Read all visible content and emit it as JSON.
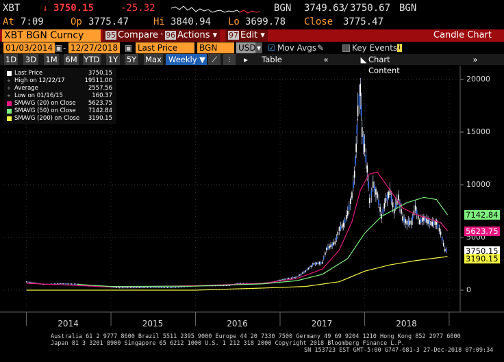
{
  "quote": {
    "ticker": "XBT",
    "arrow": "↓",
    "last": "3750.15",
    "change": "-25.32",
    "source": "BGN",
    "bid": "3749.63",
    "ask": "3750.67",
    "source2": "BGN",
    "at_label": "At",
    "time": "7:09",
    "op_label": "Op",
    "open": "3775.47",
    "hi_label": "Hi",
    "high": "3840.94",
    "lo_label": "Lo",
    "low": "3699.78",
    "close_label": "Close",
    "close": "3775.47"
  },
  "menubar": {
    "security": "XBT BGN Curncy",
    "compare_num": "95",
    "compare": "Compare",
    "actions_num": "96",
    "actions": "Actions",
    "edit_num": "97",
    "edit": "Edit",
    "chart_type": "Candle Chart"
  },
  "controls": {
    "start_date": "01/03/2014",
    "end_date": "12/27/2018",
    "field": "Last Price",
    "source": "BGN",
    "currency": "USD",
    "mov_avgs": "Mov Avgs",
    "key_events": "Key Events"
  },
  "periods": {
    "items": [
      "1D",
      "3D",
      "1M",
      "6M",
      "YTD",
      "1Y",
      "5Y",
      "Max"
    ],
    "frequency": "Weekly",
    "table": "Table",
    "chart_content": "Chart Content"
  },
  "legend": {
    "rows": [
      {
        "label": "Last Price",
        "value": "3750.15",
        "color": "#ffffff"
      },
      {
        "label": "High on 12/22/17",
        "value": "19511.00",
        "color": "#ffffff"
      },
      {
        "label": "Average",
        "value": "2557.56",
        "color": "#ffffff"
      },
      {
        "label": "Low on 01/16/15",
        "value": "160.37",
        "color": "#ffffff"
      },
      {
        "label": "SMAVG (20)  on Close",
        "value": "5623.75",
        "color": "#e8177f"
      },
      {
        "label": "SMAVG (50)  on Close",
        "value": "7142.84",
        "color": "#7ef07e"
      },
      {
        "label": "SMAVG (200)  on Close",
        "value": "3190.15",
        "color": "#f5f542"
      }
    ]
  },
  "tags": {
    "sma50": "7142.84",
    "sma20": "5623.75",
    "last": "3750.15",
    "sma200": "3190.15"
  },
  "chart_data": {
    "type": "line",
    "y_ticks": [
      "20000",
      "15000",
      "10000",
      "5000",
      "0"
    ],
    "ylim": [
      -1500,
      21500
    ],
    "x_ticks": [
      "2014",
      "2015",
      "2016",
      "2017",
      "2018"
    ],
    "series": [
      {
        "name": "Last Price",
        "color": "#4a90ff",
        "x": [
          2014.0,
          2014.2,
          2014.4,
          2014.6,
          2014.8,
          2015.0,
          2015.1,
          2015.3,
          2015.5,
          2015.7,
          2015.9,
          2016.0,
          2016.2,
          2016.4,
          2016.5,
          2016.7,
          2016.9,
          2017.0,
          2017.1,
          2017.2,
          2017.3,
          2017.4,
          2017.5,
          2017.55,
          2017.6,
          2017.65,
          2017.7,
          2017.75,
          2017.8,
          2017.85,
          2017.88,
          2017.9,
          2017.92,
          2017.95,
          2017.97,
          2018.0,
          2018.03,
          2018.06,
          2018.1,
          2018.15,
          2018.2,
          2018.25,
          2018.3,
          2018.35,
          2018.4,
          2018.45,
          2018.5,
          2018.55,
          2018.6,
          2018.65,
          2018.7,
          2018.75,
          2018.8,
          2018.85,
          2018.9,
          2018.95,
          2018.98
        ],
        "y": [
          800,
          550,
          620,
          580,
          400,
          300,
          230,
          240,
          270,
          240,
          350,
          430,
          420,
          450,
          650,
          610,
          730,
          950,
          1100,
          1250,
          1800,
          2500,
          2600,
          3900,
          4200,
          4500,
          5800,
          6200,
          7300,
          9000,
          11000,
          13500,
          17000,
          19000,
          15000,
          13500,
          11500,
          8500,
          10000,
          9000,
          7000,
          8500,
          9300,
          7500,
          8800,
          6800,
          6400,
          6400,
          7800,
          6500,
          6800,
          6500,
          6300,
          6400,
          5400,
          3800,
          3750
        ]
      },
      {
        "name": "SMAVG (20)",
        "color": "#e8177f",
        "x": [
          2014.0,
          2015.0,
          2016.0,
          2016.8,
          2017.2,
          2017.5,
          2017.7,
          2017.85,
          2017.95,
          2018.05,
          2018.15,
          2018.3,
          2018.45,
          2018.6,
          2018.75,
          2018.9,
          2018.98
        ],
        "y": [
          650,
          300,
          420,
          650,
          1100,
          2000,
          3800,
          6500,
          9500,
          11000,
          11200,
          9500,
          7800,
          7200,
          6800,
          6400,
          5624
        ]
      },
      {
        "name": "SMAVG (50)",
        "color": "#7ef07e",
        "x": [
          2014.6,
          2015.0,
          2016.0,
          2016.8,
          2017.2,
          2017.5,
          2017.8,
          2018.0,
          2018.2,
          2018.5,
          2018.7,
          2018.85,
          2018.98
        ],
        "y": [
          550,
          350,
          380,
          600,
          900,
          1500,
          3000,
          5400,
          7000,
          8300,
          8800,
          8600,
          7143
        ]
      },
      {
        "name": "SMAVG (200)",
        "color": "#f5f542",
        "x": [
          2014.0,
          2015.0,
          2016.0,
          2016.8,
          2017.3,
          2017.7,
          2018.0,
          2018.3,
          2018.6,
          2018.98
        ],
        "y": [
          0,
          0,
          0,
          200,
          350,
          800,
          1800,
          2400,
          2800,
          3190
        ]
      }
    ]
  },
  "footer": {
    "line1": "Australia 61 2 9777 8600 Brazil 5511 2395 9000 Europe 44 20 7330 7500 Germany 49 69 9204 1210 Hong Kong 852 2977 6000",
    "line2": "Japan 81 3 3201 8900       Singapore 65 6212 1000       U.S. 1 212 318 2000           Copyright 2018 Bloomberg Finance L.P.",
    "line3": "SN 153723 EST  GMT-5:00 G747-681-3 27-Dec-2018 07:09:34"
  }
}
